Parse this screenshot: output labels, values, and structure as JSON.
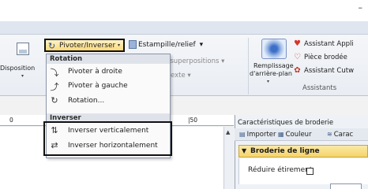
{
  "window": {
    "minimize_icon": "minimize-icon",
    "minimize_glyph": "–"
  },
  "ribbon": {
    "disposition": {
      "label": "Disposition",
      "arrow": "▾"
    },
    "pivot": {
      "label": "Pivoter/Inverser",
      "arrow": "▾",
      "icon": "rotate-icon"
    },
    "stamp": {
      "label": "Estampille/relief",
      "arrow": "▾",
      "icon": "stamp-icon"
    },
    "superpositions_text": "es superpositions ▾",
    "texte_text": "exte ▾",
    "fill": {
      "line1": "Remplissage",
      "line2": "d'arrière-plan",
      "arrow": "▾"
    },
    "assistants": [
      {
        "label": "Assistant Appli",
        "icon": "heart-icon",
        "color": "#d9362b"
      },
      {
        "label": "Pièce brodée",
        "icon": "heart-outline-icon",
        "color": "#d9362b"
      },
      {
        "label": "Assistant Cutw",
        "icon": "flower-icon",
        "color": "#c0392b"
      }
    ],
    "assistants_group_label": "Assistants"
  },
  "ruler": {
    "tick_0": "0",
    "tick_50": "|50"
  },
  "menu": {
    "rotation_header": "Rotation",
    "rotation_items": [
      {
        "label": "Pivoter à droite",
        "icon": "rotate-right-icon"
      },
      {
        "label": "Pivoter à gauche",
        "icon": "rotate-left-icon"
      },
      {
        "label": "Rotation...",
        "icon": "rotation-icon"
      }
    ],
    "inverser_header": "Inverser",
    "inverser_items": [
      {
        "label": "Inverser verticalement",
        "icon": "flip-vertical-icon"
      },
      {
        "label": "Inverser horizontalement",
        "icon": "flip-horizontal-icon"
      }
    ]
  },
  "panel": {
    "title": "Caractéristiques de broderie",
    "toolbar": [
      {
        "label": "Importer",
        "icon": "import-icon"
      },
      {
        "label": "Couleur",
        "icon": "color-icon"
      },
      {
        "label": "Carac",
        "icon": "characteristics-icon"
      }
    ],
    "section_title": "Broderie de ligne",
    "reduce_label": "Réduire étirement"
  }
}
